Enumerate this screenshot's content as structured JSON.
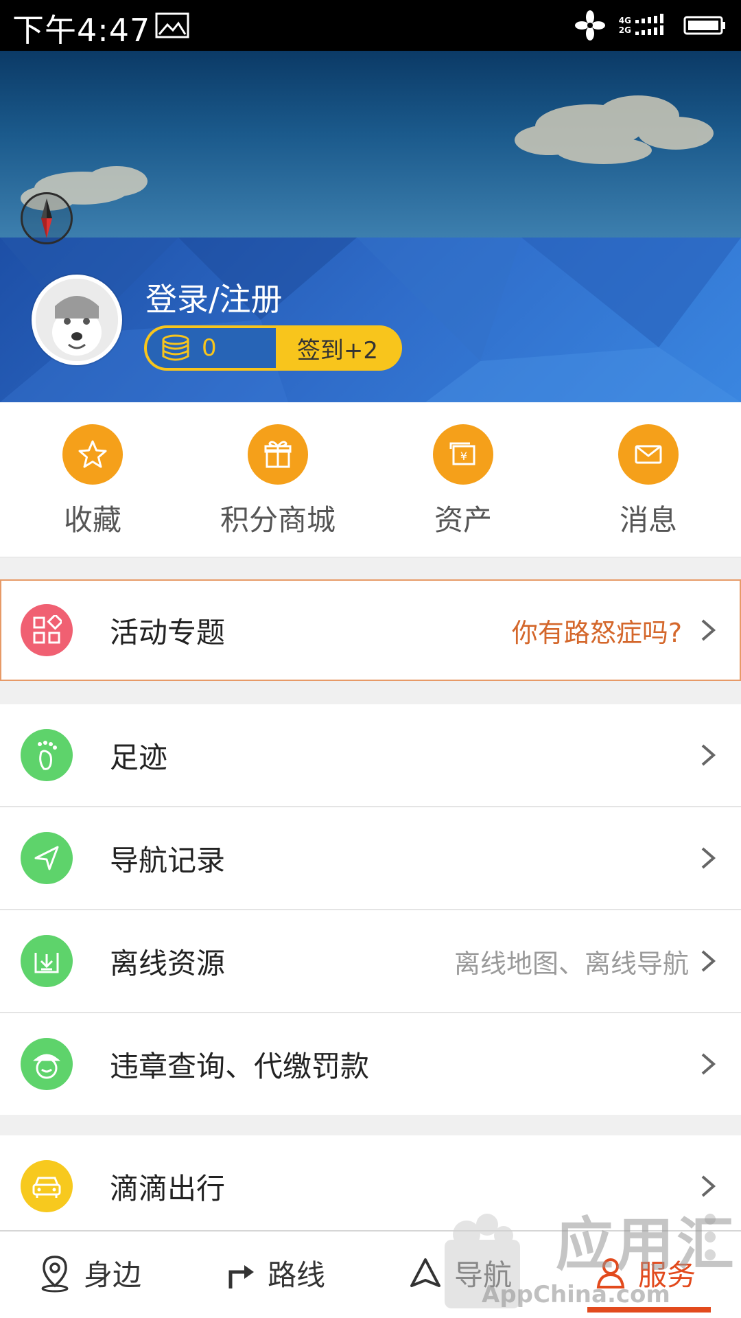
{
  "status_bar": {
    "time": "下午4:47",
    "net_top": "4G",
    "net_bottom": "2G"
  },
  "header": {
    "login_label": "登录/注册",
    "points_value": "0",
    "sign_in_label": "签到+2"
  },
  "quick_actions": [
    {
      "label": "收藏",
      "icon": "star-icon"
    },
    {
      "label": "积分商城",
      "icon": "gift-icon"
    },
    {
      "label": "资产",
      "icon": "wallet-icon"
    },
    {
      "label": "消息",
      "icon": "envelope-icon"
    }
  ],
  "activity": {
    "title": "活动专题",
    "subtitle": "你有路怒症吗?"
  },
  "list": [
    {
      "title": "足迹",
      "subtitle": ""
    },
    {
      "title": "导航记录",
      "subtitle": ""
    },
    {
      "title": "离线资源",
      "subtitle": "离线地图、离线导航"
    },
    {
      "title": "违章查询、代缴罚款",
      "subtitle": ""
    }
  ],
  "didi": {
    "title": "滴滴出行"
  },
  "bottom_nav": [
    {
      "label": "身边",
      "icon": "location-pin-icon"
    },
    {
      "label": "路线",
      "icon": "route-arrow-icon"
    },
    {
      "label": "导航",
      "icon": "navigate-triangle-icon"
    },
    {
      "label": "服务",
      "icon": "user-service-icon",
      "active": true
    }
  ],
  "watermark": {
    "brand_cn": "应用汇",
    "brand_en": "AppChina.com"
  },
  "colors": {
    "accent_orange": "#f5a01a",
    "activity_text": "#d4672b",
    "green_icon": "#5ed36b",
    "yellow_icon": "#f7c91e",
    "nav_active": "#e24a1d"
  }
}
